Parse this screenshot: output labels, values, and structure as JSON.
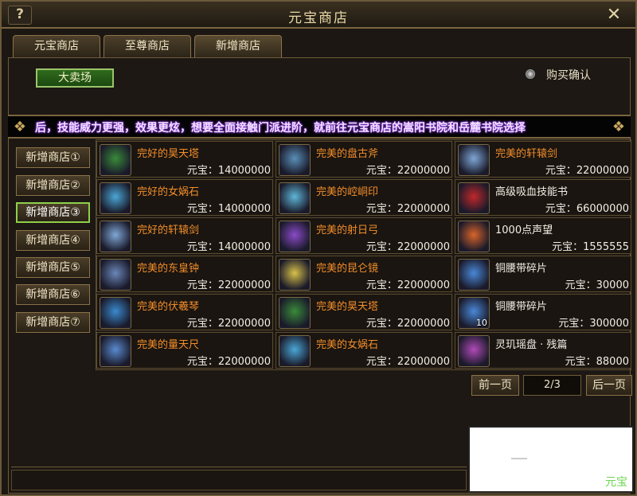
{
  "window": {
    "title": "元宝商店",
    "help_label": "?",
    "close_label": "✕"
  },
  "tabs": [
    {
      "label": "元宝商店"
    },
    {
      "label": "至尊商店"
    },
    {
      "label": "新增商店"
    }
  ],
  "market_button": "大卖场",
  "purchase_confirm": "购买确认",
  "marquee": "后，技能威力更强，效果更炫，想要全面接触门派进阶，就前往元宝商店的嵩阳书院和岳麓书院选择",
  "side_nav": [
    {
      "label": "新增商店①"
    },
    {
      "label": "新增商店②"
    },
    {
      "label": "新增商店③"
    },
    {
      "label": "新增商店④"
    },
    {
      "label": "新增商店⑤"
    },
    {
      "label": "新增商店⑥"
    },
    {
      "label": "新增商店⑦"
    }
  ],
  "items": [
    {
      "name": "完好的昊天塔",
      "price": "元宝：14000000",
      "icon": "tower-icon",
      "color": "#3a8a3a"
    },
    {
      "name": "完美的盘古斧",
      "price": "元宝：22000000",
      "icon": "axe-icon",
      "color": "#5a8fb8"
    },
    {
      "name": "完美的轩辕剑",
      "price": "元宝：22000000",
      "icon": "sword-icon",
      "color": "#7fa7d6"
    },
    {
      "name": "完好的女娲石",
      "price": "元宝：14000000",
      "icon": "stone-icon",
      "color": "#4aa7d6"
    },
    {
      "name": "完美的崆峒印",
      "price": "元宝：22000000",
      "icon": "seal-icon",
      "color": "#5fb6d8"
    },
    {
      "name": "高级吸血技能书",
      "price": "元宝：66000000",
      "icon": "skill-book-icon",
      "color": "#c0282a"
    },
    {
      "name": "完好的轩辕剑",
      "price": "元宝：14000000",
      "icon": "sword-icon",
      "color": "#7fa7d6"
    },
    {
      "name": "完美的射日弓",
      "price": "元宝：22000000",
      "icon": "bow-icon",
      "color": "#8a4ac8"
    },
    {
      "name": "1000点声望",
      "price": "元宝：1555555",
      "icon": "reputation-icon",
      "color": "#d8642a"
    },
    {
      "name": "完美的东皇钟",
      "price": "元宝：22000000",
      "icon": "bell-icon",
      "color": "#6a86b8"
    },
    {
      "name": "完美的昆仑镜",
      "price": "元宝：22000000",
      "icon": "mirror-icon",
      "color": "#d8c04a"
    },
    {
      "name": "铜腰带碎片",
      "price": "元宝：30000",
      "icon": "belt-fragment-icon",
      "color": "#4a88d8"
    },
    {
      "name": "完美的伏羲琴",
      "price": "元宝：22000000",
      "icon": "zither-icon",
      "color": "#3a8ad0"
    },
    {
      "name": "完美的昊天塔",
      "price": "元宝：22000000",
      "icon": "tower-icon",
      "color": "#3a8a3a"
    },
    {
      "name": "铜腰带碎片",
      "price": "元宝：300000",
      "icon": "belt-fragment-icon",
      "color": "#4a88d8",
      "qty": "10"
    },
    {
      "name": "完美的量天尺",
      "price": "元宝：22000000",
      "icon": "ruler-icon",
      "color": "#5a8ad0"
    },
    {
      "name": "完美的女娲石",
      "price": "元宝：22000000",
      "icon": "stone-icon",
      "color": "#4aa7d6"
    },
    {
      "name": "灵玑瑶盘 · 残篇",
      "price": "元宝：88000",
      "icon": "jade-disc-icon",
      "color": "#b04ab8"
    }
  ],
  "pager": {
    "prev": "前一页",
    "info": "2/3",
    "next": "后一页"
  },
  "overlay_text": "元宝"
}
